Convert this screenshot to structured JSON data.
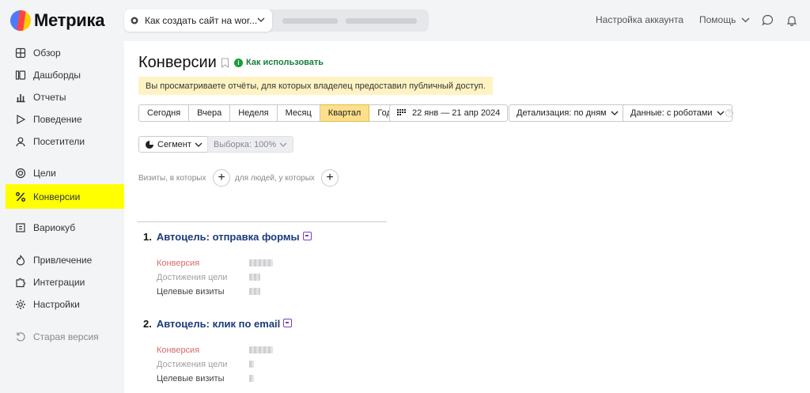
{
  "app": {
    "name": "Метрика"
  },
  "site": {
    "name": "Как создать сайт на wor..."
  },
  "top_links": {
    "account": "Настройка аккаунта",
    "help": "Помощь"
  },
  "sidebar": {
    "items": [
      {
        "label": "Обзор",
        "icon": "grid-icon"
      },
      {
        "label": "Дашборды",
        "icon": "dashboards-icon"
      },
      {
        "label": "Отчеты",
        "icon": "bar-chart-icon"
      },
      {
        "label": "Поведение",
        "icon": "play-icon"
      },
      {
        "label": "Посетители",
        "icon": "person-icon"
      },
      {
        "label": "Цели",
        "icon": "target-icon"
      },
      {
        "label": "Конверсии",
        "icon": "percent-icon",
        "active": true
      },
      {
        "label": "Вариокуб",
        "icon": "cube-icon"
      },
      {
        "label": "Привлечение",
        "icon": "flame-icon"
      },
      {
        "label": "Интеграции",
        "icon": "puzzle-icon"
      },
      {
        "label": "Настройки",
        "icon": "gear-icon"
      },
      {
        "label": "Старая версия",
        "icon": "undo-icon"
      }
    ]
  },
  "page": {
    "title": "Конверсии",
    "howto": "Как использовать",
    "notice": "Вы просматриваете отчёты, для которых владелец предоставил публичный доступ."
  },
  "periods": [
    "Сегодня",
    "Вчера",
    "Неделя",
    "Месяц",
    "Квартал",
    "Год"
  ],
  "selected_period": "Квартал",
  "date_range": "22 янв — 21 апр 2024",
  "detail": "Детализация: по дням",
  "data_mode": "Данные: с роботами",
  "segment": "Сегмент",
  "sample": "Выборка: 100%",
  "filter": {
    "visits": "Визиты, в которых",
    "people": "для людей, у которых"
  },
  "goals": [
    {
      "num": "1.",
      "title": "Автоцель: отправка формы",
      "metrics": [
        "Конверсия",
        "Достижения цели",
        "Целевые визиты"
      ]
    },
    {
      "num": "2.",
      "title": "Автоцель: клик по email",
      "metrics": [
        "Конверсия",
        "Достижения цели",
        "Целевые визиты"
      ]
    }
  ],
  "colors": {
    "active_nav": "#ffff00",
    "selected_period": "#ffe08a",
    "notice": "#fff3c4",
    "goal_title": "#1b3a7a",
    "conversion": "#d86b6b"
  }
}
